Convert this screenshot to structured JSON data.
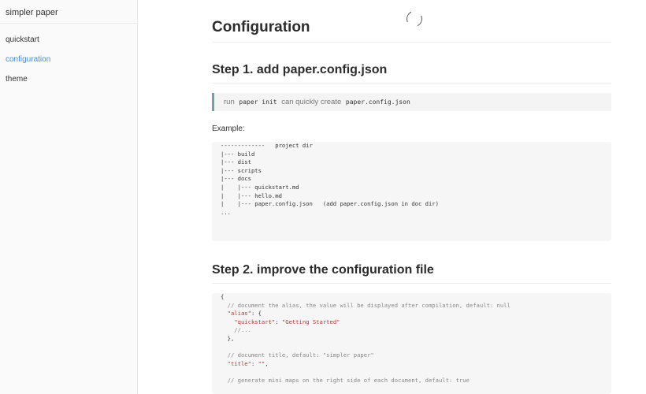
{
  "sidebar": {
    "site_title": "simpler paper",
    "items": [
      {
        "label": "quickstart",
        "active": false
      },
      {
        "label": "configuration",
        "active": true
      },
      {
        "label": "theme",
        "active": false
      }
    ]
  },
  "main": {
    "title": "Configuration",
    "step1": {
      "heading": "Step 1. add paper.config.json",
      "tip_prefix": "run",
      "tip_command": "paper init",
      "tip_middle": "can quickly create",
      "tip_file": "paper.config.json",
      "example_label": "Example:",
      "tree_lines": [
        "-------------   project dir",
        "|--- build",
        "|--- dist",
        "|--- scripts",
        "|--- docs",
        "|    |--- quickstart.md",
        "|    |--- hello.md",
        "|    |--- paper.config.json   (add paper.config.json in doc dir)",
        "..."
      ]
    },
    "step2": {
      "heading": "Step 2. improve the configuration file",
      "config_lines": [
        {
          "text": "{",
          "kind": "plain"
        },
        {
          "text": "  // document the alias, the value will be displayed after compilation, default: null",
          "kind": "comment"
        },
        {
          "text": "  \"alias\": {",
          "kind": "key"
        },
        {
          "text": "    \"quickstart\": \"Getting Started\"",
          "kind": "key"
        },
        {
          "text": "    //...",
          "kind": "comment"
        },
        {
          "text": "  },",
          "kind": "plain"
        },
        {
          "text": "",
          "kind": "plain"
        },
        {
          "text": "  // document title, default: \"simpler paper\"",
          "kind": "comment"
        },
        {
          "text": "  \"title\": \"\",",
          "kind": "key"
        },
        {
          "text": "",
          "kind": "plain"
        },
        {
          "text": "  // generate mini maps on the right side of each document, default: true",
          "kind": "comment"
        }
      ]
    }
  },
  "colors": {
    "accent": "#4a8bd6",
    "tip_border": "#6fa3a6",
    "key": "#b03a2e",
    "comment": "#888888"
  },
  "icons": {
    "loading": "loading-spinner-icon"
  }
}
